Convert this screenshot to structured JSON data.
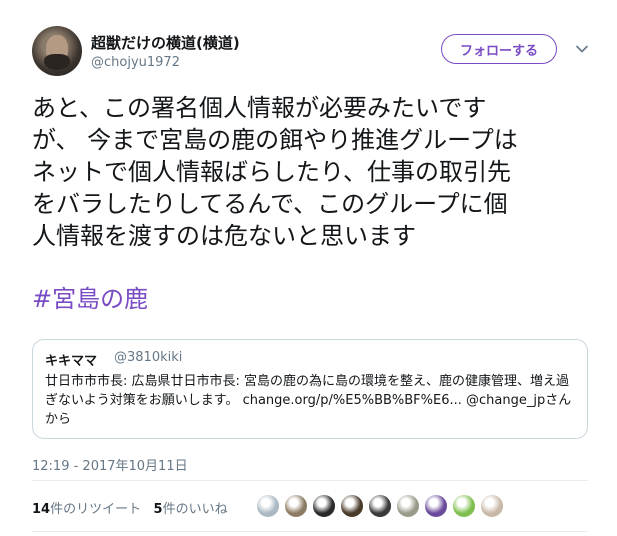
{
  "user": {
    "display_name": "超獣だけの横道(横道)",
    "handle": "@chojyu1972",
    "follow_label": "フォローする"
  },
  "tweet": {
    "text": "あと、この署名個人情報が必要みたいです\nが、 今まで宮島の鹿の餌やり推進グループは\nネットで個人情報ばらしたり、仕事の取引先\nをバラしたりしてるんで、このグループに個\n人情報を渡すのは危ないと思います",
    "hashtag": "#宮島の鹿",
    "timestamp": "12:19 - 2017年10月11日"
  },
  "quote": {
    "name": "キキママ",
    "handle": "@3810kiki",
    "text": "廿日市市市長: 広島県廿日市市長: 宮島の鹿の為に島の環境を整え、鹿の健康管理、増え過ぎないよう対策をお願いします。 change.org/p/%E5%BB%BF%E6... @change_jpさんから"
  },
  "stats": {
    "retweets_count": "14",
    "retweets_label": "件のリツイート",
    "likes_count": "5",
    "likes_label": "件のいいね"
  },
  "colors": {
    "accent": "#794bc4",
    "muted": "#657786",
    "text": "#14171a",
    "border": "#ccd6dd"
  },
  "likers": [
    {
      "icon": "default-avatar",
      "color": "#aab8c2"
    },
    {
      "icon": "cat-avatar",
      "color": "#8c7b63"
    },
    {
      "icon": "anime-avatar",
      "color": "#2a2a2a"
    },
    {
      "icon": "photo-avatar",
      "color": "#4a3a2a"
    },
    {
      "icon": "photo-avatar",
      "color": "#3a3a3a"
    },
    {
      "icon": "bird-avatar",
      "color": "#9a9a8a"
    },
    {
      "icon": "pattern-avatar",
      "color": "#6a4a9a"
    },
    {
      "icon": "flower-avatar",
      "color": "#7fbf4f"
    },
    {
      "icon": "person-avatar",
      "color": "#c9b8a8"
    }
  ]
}
